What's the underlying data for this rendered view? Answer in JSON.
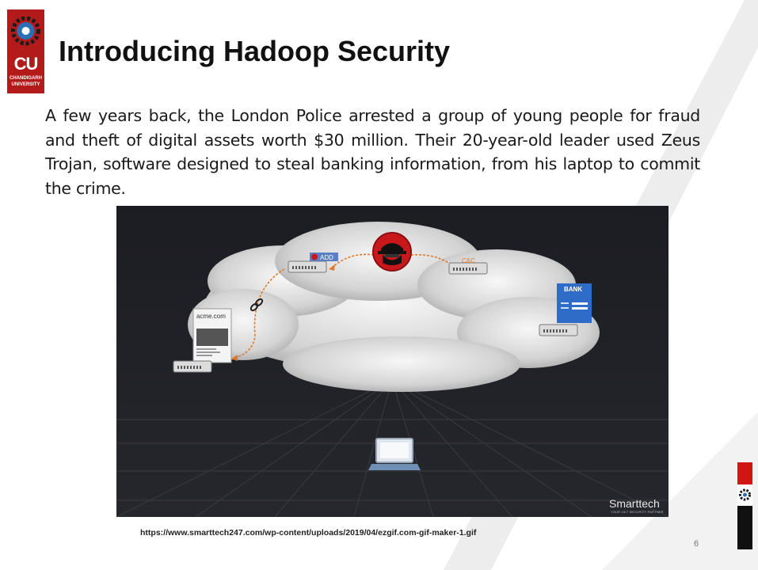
{
  "slide": {
    "title": "Introducing Hadoop Security",
    "body": "A few years back, the London Police arrested a group of young people for fraud and theft of digital assets worth $30 million. Their 20-year-old leader used Zeus Trojan, software designed to steal banking information, from his laptop to commit the crime.",
    "source_url": "https://www.smarttech247.com/wp-content/uploads/2019/04/ezgif.com-gif-maker-1.gif",
    "page_number": "6"
  },
  "logo": {
    "initials": "CU",
    "line1": "CHANDIGARH",
    "line2": "UNIVERSITY"
  },
  "illustration": {
    "site_label": "acme.com",
    "add_label": "ADD",
    "cc_label": "C&C",
    "bank_label": "BANK",
    "brand_name": "Smarttech",
    "brand_tagline": "YOUR 24/7 SECURITY PARTNER"
  },
  "colors": {
    "brand_red": "#b31b1b",
    "accent_red": "#d11414",
    "arrow_orange": "#e07a2a",
    "bank_blue": "#2e6cc7"
  }
}
